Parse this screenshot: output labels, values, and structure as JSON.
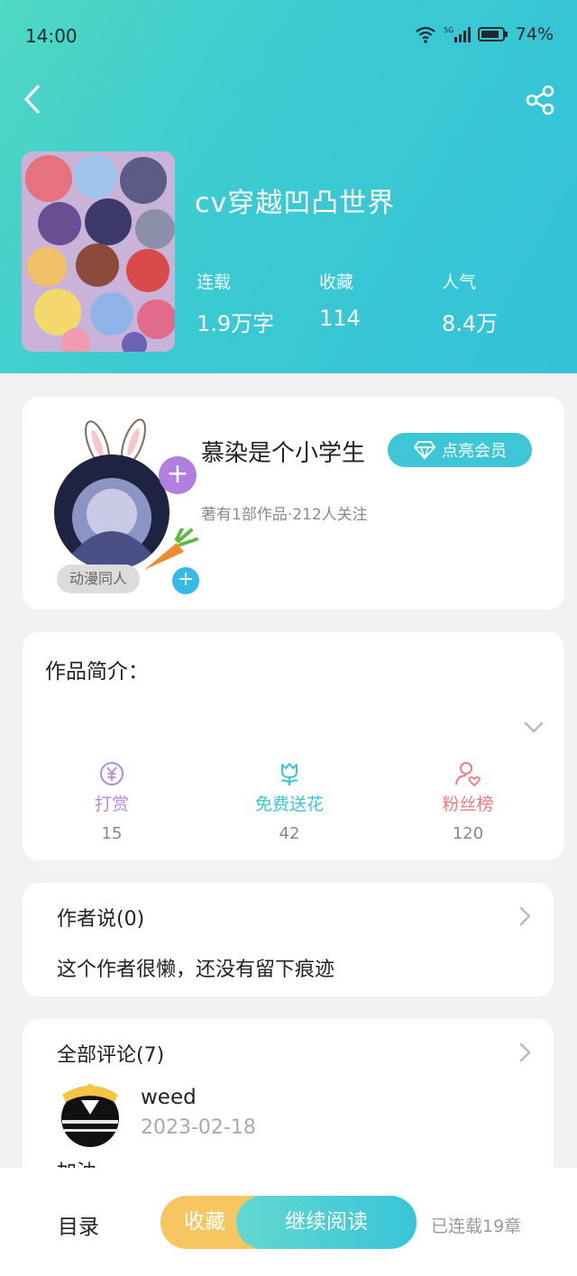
{
  "status_bar": {
    "time": "14:00",
    "network": "5G",
    "battery": "74%"
  },
  "book": {
    "title": "cv穿越凹凸世界",
    "stats": [
      {
        "label": "连载",
        "value": "1.9万字"
      },
      {
        "label": "收藏",
        "value": "114"
      },
      {
        "label": "人气",
        "value": "8.4万"
      }
    ]
  },
  "author": {
    "name": "慕染是个小学生",
    "vip_label": "点亮会员",
    "meta": "著有1部作品·212人关注",
    "tag": "动漫同人",
    "plus": "+"
  },
  "intro": {
    "title": "作品简介：",
    "actions": [
      {
        "label": "打赏",
        "count": "15",
        "color": "#b68ae0",
        "icon": "yuan-coin-icon"
      },
      {
        "label": "免费送花",
        "count": "42",
        "color": "#3cc6d6",
        "icon": "flower-icon"
      },
      {
        "label": "粉丝榜",
        "count": "120",
        "color": "#f07b7b",
        "icon": "fan-user-heart-icon"
      }
    ]
  },
  "author_says": {
    "title": "作者说(0)",
    "text": "这个作者很懒，还没有留下痕迹"
  },
  "comments": {
    "title": "全部评论(7)",
    "items": [
      {
        "user": "weed",
        "date": "2023-02-18",
        "text": "加油"
      }
    ]
  },
  "bottom_bar": {
    "toc": "目录",
    "favorite": "收藏",
    "continue": "继续阅读",
    "chapters": "已连载19章"
  },
  "colors": {
    "header_start": "#4fd8c3",
    "header_end": "#33c2d8",
    "accent": "#3cc6d6",
    "favorite": "#f6c661"
  }
}
